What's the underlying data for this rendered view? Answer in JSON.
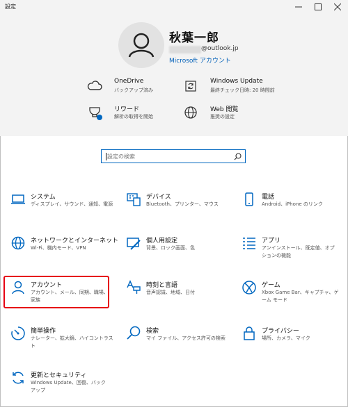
{
  "window": {
    "title": "設定"
  },
  "profile": {
    "name": "秋葉一郎",
    "email_suffix": "@outlook.jp",
    "account_link": "Microsoft アカウント"
  },
  "header_items": [
    {
      "title": "OneDrive",
      "desc": "バックアップ済み",
      "icon": "cloud-icon"
    },
    {
      "title": "Windows Update",
      "desc": "最終チェック日時: 20 時間前",
      "icon": "sync-icon"
    },
    {
      "title": "リワード",
      "desc": "解析の取得を開始",
      "icon": "trophy-icon"
    },
    {
      "title": "Web 閲覧",
      "desc": "推奨の設定",
      "icon": "globe-icon"
    }
  ],
  "search": {
    "placeholder": "設定の検索"
  },
  "categories": [
    {
      "title": "システム",
      "desc": "ディスプレイ、サウンド、通知、電源",
      "icon": "laptop-icon"
    },
    {
      "title": "デバイス",
      "desc": "Bluetooth、プリンター、マウス",
      "icon": "keyboard-icon"
    },
    {
      "title": "電話",
      "desc": "Android、iPhone のリンク",
      "icon": "phone-icon"
    },
    {
      "title": "ネットワークとインターネット",
      "desc": "Wi-Fi、機内モード、VPN",
      "icon": "network-globe-icon"
    },
    {
      "title": "個人用設定",
      "desc": "背景、ロック画面、色",
      "icon": "personalization-icon"
    },
    {
      "title": "アプリ",
      "desc": "アンインストール、既定値、オプションの機能",
      "icon": "apps-list-icon"
    },
    {
      "title": "アカウント",
      "desc": "アカウント、メール、同期、職場、家族",
      "icon": "person-icon"
    },
    {
      "title": "時刻と言語",
      "desc": "音声認識、地域、日付",
      "icon": "time-language-icon"
    },
    {
      "title": "ゲーム",
      "desc": "Xbox Game Bar、キャプチャ、ゲーム モード",
      "icon": "xbox-icon"
    },
    {
      "title": "簡単操作",
      "desc": "ナレーター、拡大鏡、ハイコントラスト",
      "icon": "ease-of-access-icon"
    },
    {
      "title": "検索",
      "desc": "マイ ファイル、アクセス許可の検索",
      "icon": "search-icon"
    },
    {
      "title": "プライバシー",
      "desc": "場所、カメラ、マイク",
      "icon": "lock-icon"
    },
    {
      "title": "更新とセキュリティ",
      "desc": "Windows Update、回復、バックアップ",
      "icon": "update-icon"
    }
  ],
  "colors": {
    "accent": "#0067c0",
    "highlight": "#e60012",
    "header_bg": "#f3f3f3"
  }
}
